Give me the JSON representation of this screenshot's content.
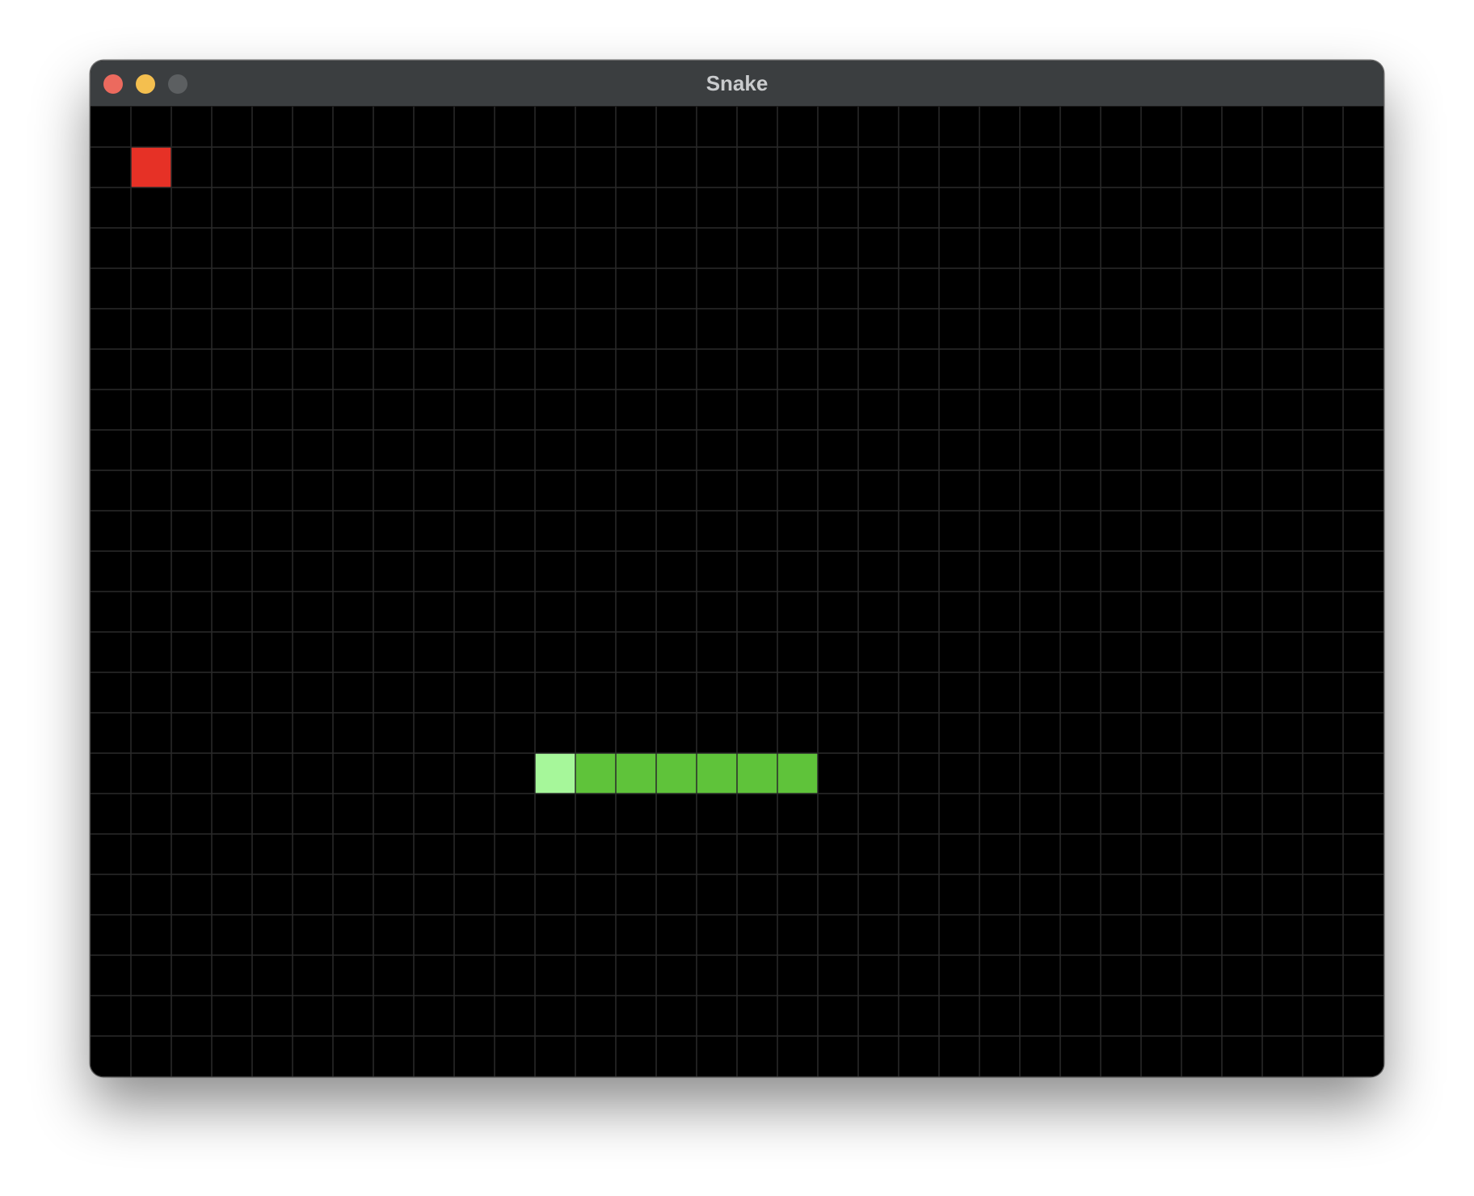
{
  "window": {
    "title": "Snake",
    "controls": {
      "close_icon": "close-icon",
      "minimize_icon": "minimize-icon",
      "zoom_icon": "zoom-icon"
    }
  },
  "game": {
    "grid": {
      "columns": 32,
      "rows": 24
    },
    "colors": {
      "background": "#000000",
      "grid_line": "#2a2a2a",
      "snake_head": "#a6f79a",
      "snake_body": "#5fc33a",
      "food": "#e63126"
    },
    "food": {
      "col": 1,
      "row": 1
    },
    "snake": {
      "direction": "left",
      "segments": [
        {
          "col": 11,
          "row": 16
        },
        {
          "col": 12,
          "row": 16
        },
        {
          "col": 13,
          "row": 16
        },
        {
          "col": 14,
          "row": 16
        },
        {
          "col": 15,
          "row": 16
        },
        {
          "col": 16,
          "row": 16
        },
        {
          "col": 17,
          "row": 16
        }
      ]
    }
  }
}
